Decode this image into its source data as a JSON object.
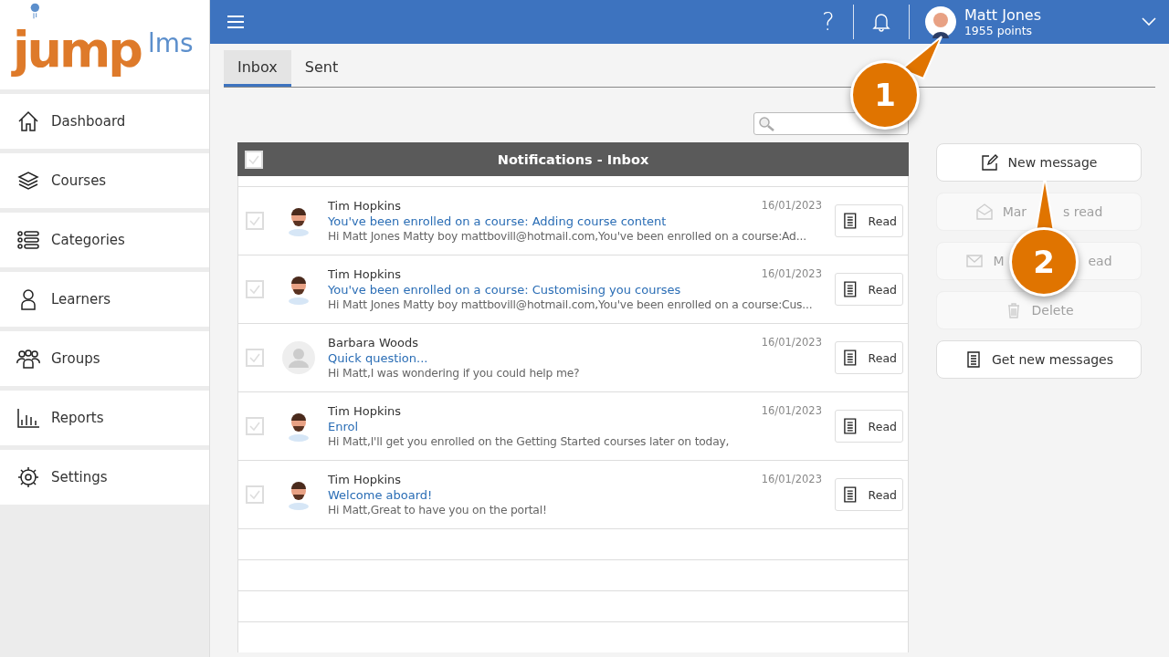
{
  "logo": {
    "main": "jump",
    "suffix": "lms"
  },
  "sidebar": {
    "items": [
      {
        "label": "Dashboard"
      },
      {
        "label": "Courses"
      },
      {
        "label": "Categories"
      },
      {
        "label": "Learners"
      },
      {
        "label": "Groups"
      },
      {
        "label": "Reports"
      },
      {
        "label": "Settings"
      }
    ]
  },
  "topbar": {
    "help": "?",
    "user": {
      "name": "Matt Jones",
      "points": "1955 points"
    }
  },
  "tabs": [
    {
      "label": "Inbox",
      "selected": true
    },
    {
      "label": "Sent",
      "selected": false
    }
  ],
  "table": {
    "title": "Notifications - Inbox",
    "header_checked": false,
    "rows": [
      {
        "sender": "Tim Hopkins",
        "kind": "photo",
        "date": "16/01/2023",
        "subject": "You've been enrolled on a course: Adding course content",
        "preview": "Hi Matt Jones Matty boy mattbovill@hotmail.com,You've been enrolled on a course:Ad...",
        "checked": false,
        "action": "Read"
      },
      {
        "sender": "Tim Hopkins",
        "kind": "photo",
        "date": "16/01/2023",
        "subject": "You've been enrolled on a course: Customising you courses",
        "preview": "Hi Matt Jones Matty boy mattbovill@hotmail.com,You've been enrolled on a course:Cus...",
        "checked": false,
        "action": "Read"
      },
      {
        "sender": "Barbara Woods",
        "kind": "default",
        "date": "16/01/2023",
        "subject": "Quick question...",
        "preview": "Hi Matt,I was wondering if you could help me?",
        "checked": false,
        "action": "Read"
      },
      {
        "sender": "Tim Hopkins",
        "kind": "photo",
        "date": "16/01/2023",
        "subject": "Enrol",
        "preview": "Hi Matt,I'll get you enrolled on the Getting Started courses later on today,",
        "checked": false,
        "action": "Read"
      },
      {
        "sender": "Tim Hopkins",
        "kind": "photo",
        "date": "16/01/2023",
        "subject": "Welcome aboard!",
        "preview": "Hi Matt,Great to have you on the portal!",
        "checked": false,
        "action": "Read"
      }
    ]
  },
  "actions": [
    {
      "kind": "compose",
      "label_parts": [
        "New message"
      ],
      "disabled": false
    },
    {
      "kind": "open-envelope",
      "label_parts": [
        "Mar",
        "s read"
      ],
      "disabled": true
    },
    {
      "kind": "envelope",
      "label_parts": [
        "M",
        "ead"
      ],
      "disabled": true
    },
    {
      "kind": "trash",
      "label_parts": [
        "Delete"
      ],
      "disabled": true
    },
    {
      "kind": "document",
      "label_parts": [
        "Get new messages"
      ],
      "disabled": false
    }
  ],
  "callouts": [
    {
      "number": "1"
    },
    {
      "number": "2"
    }
  ]
}
